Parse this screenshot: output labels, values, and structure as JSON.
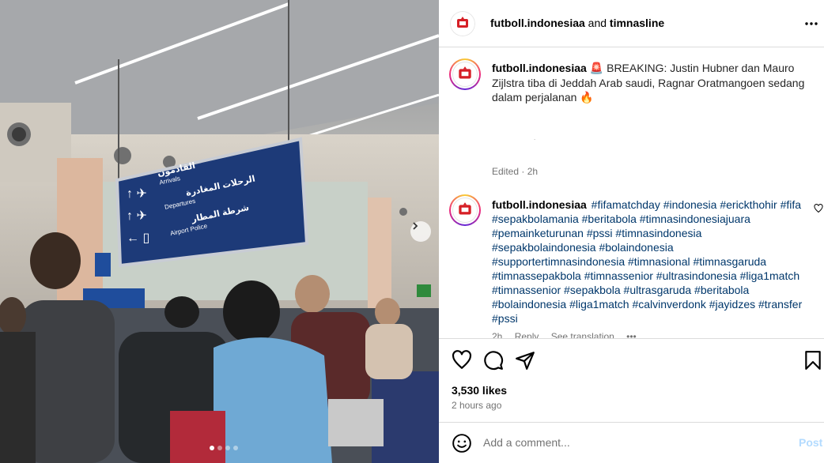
{
  "header": {
    "account": "futboll.indonesiaa",
    "and_text": "and",
    "collaborator": "timnasline"
  },
  "media": {
    "sign_arabic_1": "القادمون",
    "sign_en_1": "Arrivals",
    "sign_arabic_2": "الرحلات المغادرة",
    "sign_en_2": "Departures",
    "sign_arabic_3": "شرطة المطار",
    "sign_en_3": "Airport Police",
    "carousel_total": 4,
    "carousel_active": 1
  },
  "caption": {
    "username": "futboll.indonesiaa",
    "text": "🚨 BREAKING: Justin Hubner dan Mauro Zijlstra tiba di Jeddah Arab saudi, Ragnar Oratmangoen sedang dalam perjalanan 🔥",
    "dot": ".",
    "edited": "Edited · 2h"
  },
  "comment": {
    "username": "futboll.indonesiaa",
    "hashtags": "#fifamatchday #indonesia #erickthohir #fifa #sepakbolamania #beritabola #timnasindonesiajuara #pemainketurunan #pssi #timnasindonesia #sepakbolaindonesia #bolaindonesia #supportertimnasindonesia #timnasional #timnasgaruda #timnassepakbola #timnassenior #ultrasindonesia #liga1match #timnassenior #sepakbola #ultrasgaruda #beritabola #bolaindonesia #liga1match #calvinverdonk #jayidzes #transfer #pssi",
    "time": "2h",
    "reply": "Reply",
    "see_translation": "See translation",
    "more": "•••"
  },
  "stats": {
    "likes": "3,530 likes",
    "time_ago": "2 hours ago"
  },
  "add_comment": {
    "placeholder": "Add a comment...",
    "post_label": "Post"
  },
  "colors": {
    "link": "#00376b",
    "post_disabled": "#b3dbff",
    "muted": "#737373",
    "border": "#dbdbdb",
    "sign_blue": "#1d3a78"
  },
  "icons": [
    "more-icon",
    "heart-icon",
    "comment-icon",
    "share-icon",
    "bookmark-icon",
    "emoji-icon",
    "chevron-right-icon"
  ]
}
